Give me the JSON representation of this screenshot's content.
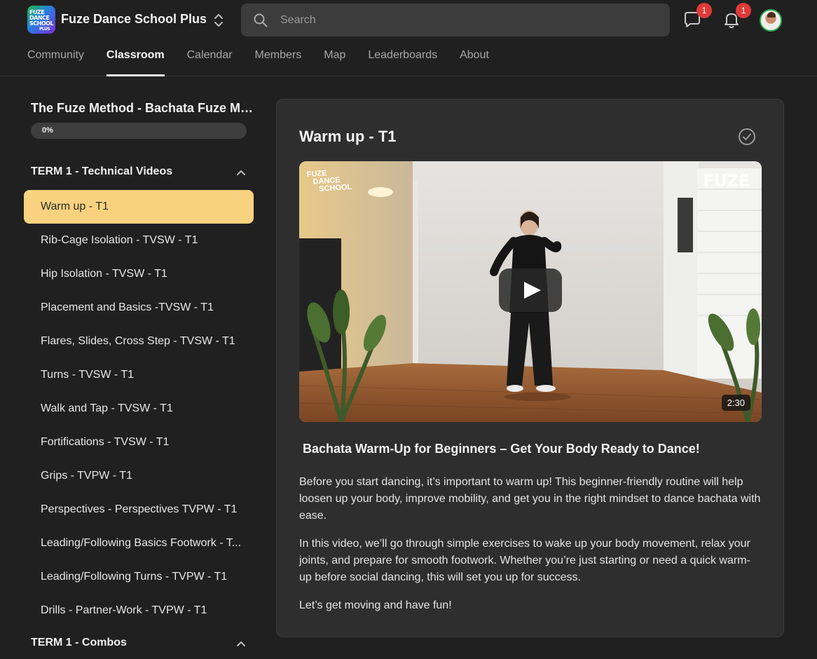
{
  "app": {
    "name": "Fuze Dance School Plus",
    "logo_text": [
      "FUZE",
      "DANCE",
      "SCHOOL",
      "PLUS"
    ]
  },
  "search": {
    "placeholder": "Search"
  },
  "notifications": {
    "chat_count": "1",
    "bell_count": "1"
  },
  "tabs": [
    {
      "label": "Community",
      "active": false
    },
    {
      "label": "Classroom",
      "active": true
    },
    {
      "label": "Calendar",
      "active": false
    },
    {
      "label": "Members",
      "active": false
    },
    {
      "label": "Map",
      "active": false
    },
    {
      "label": "Leaderboards",
      "active": false
    },
    {
      "label": "About",
      "active": false
    }
  ],
  "course": {
    "title": "The Fuze Method - Bachata Fuze Mas...",
    "progress_label": "0%",
    "progress": 0
  },
  "sections": [
    {
      "title": "TERM 1 - Technical Videos",
      "expanded": true,
      "lessons": [
        {
          "label": "Warm up - T1",
          "active": true
        },
        {
          "label": "Rib-Cage Isolation - TVSW - T1",
          "active": false
        },
        {
          "label": "Hip Isolation - TVSW - T1",
          "active": false
        },
        {
          "label": "Placement and Basics -TVSW - T1",
          "active": false
        },
        {
          "label": "Flares, Slides, Cross Step - TVSW - T1",
          "active": false
        },
        {
          "label": "Turns - TVSW - T1",
          "active": false
        },
        {
          "label": "Walk and Tap - TVSW - T1",
          "active": false
        },
        {
          "label": "Fortifications - TVSW - T1",
          "active": false
        },
        {
          "label": "Grips - TVPW - T1",
          "active": false
        },
        {
          "label": "Perspectives - Perspectives TVPW - T1",
          "active": false
        },
        {
          "label": "Leading/Following Basics Footwork - T...",
          "active": false
        },
        {
          "label": "Leading/Following Turns - TVPW - T1",
          "active": false
        },
        {
          "label": "Drills - Partner-Work - TVPW - T1",
          "active": false
        }
      ]
    },
    {
      "title": "TERM 1 - Combos",
      "expanded": true,
      "lessons": []
    }
  ],
  "lesson": {
    "title": "Warm up - T1",
    "video": {
      "watermark_left": [
        "FUZE",
        "DANCE",
        "SCHOOL"
      ],
      "watermark_right": "FUZE",
      "duration": "2:30"
    },
    "heading": "Bachata Warm-Up for Beginners – Get Your Body Ready to Dance!",
    "paragraphs": [
      "Before you start dancing, it’s important to warm up! This beginner-friendly routine will help loosen up your body, improve mobility, and get you in the right mindset to dance bachata with ease.",
      "In this video, we’ll go through simple exercises to wake up your body movement, relax your joints, and prepare for smooth footwork. Whether you’re just starting or need a quick warm-up before social dancing, this will set you up for success.",
      "Let’s get moving and have fun!"
    ]
  },
  "colors": {
    "background": "#202020",
    "card": "#2e2e2e",
    "active_lesson": "#f8d27f",
    "badge": "#e03a3a",
    "avatar_ring": "#2faa55"
  },
  "icons": [
    "logo",
    "chevron-up-down-icon",
    "search-icon",
    "chat-icon",
    "bell-icon",
    "avatar",
    "chevron-up-icon",
    "check-circle-icon",
    "play-icon"
  ]
}
